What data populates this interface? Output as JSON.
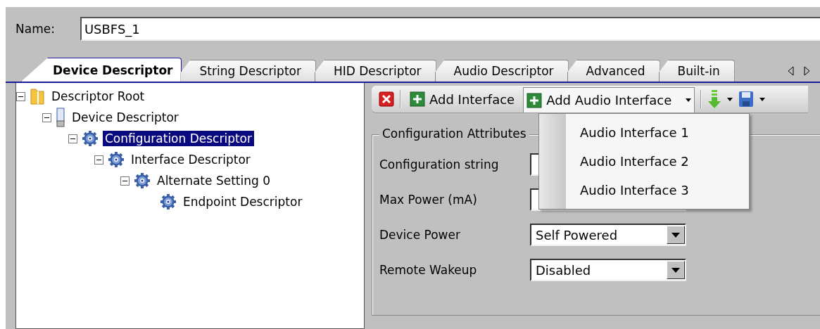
{
  "name_field": {
    "label": "Name:",
    "value": "USBFS_1"
  },
  "tabs": [
    {
      "label": "Device Descriptor",
      "selected": true
    },
    {
      "label": "String Descriptor",
      "selected": false
    },
    {
      "label": "HID Descriptor",
      "selected": false
    },
    {
      "label": "Audio Descriptor",
      "selected": false
    },
    {
      "label": "Advanced",
      "selected": false
    },
    {
      "label": "Built-in",
      "selected": false
    }
  ],
  "tree": [
    {
      "label": "Descriptor Root",
      "kind": "folder",
      "expanded": true,
      "selected": false,
      "children": [
        {
          "label": "Device Descriptor",
          "kind": "device",
          "expanded": true,
          "selected": false,
          "children": [
            {
              "label": "Configuration Descriptor",
              "kind": "gear",
              "expanded": true,
              "selected": true,
              "children": [
                {
                  "label": "Interface Descriptor",
                  "kind": "gear",
                  "expanded": true,
                  "selected": false,
                  "children": [
                    {
                      "label": "Alternate Setting 0",
                      "kind": "gear",
                      "expanded": true,
                      "selected": false,
                      "children": [
                        {
                          "label": "Endpoint Descriptor",
                          "kind": "gear",
                          "selected": false
                        }
                      ]
                    }
                  ]
                }
              ]
            }
          ]
        }
      ]
    }
  ],
  "toolbar": {
    "add_interface": "Add Interface",
    "add_audio_interface": "Add Audio Interface"
  },
  "dropdown_menu": [
    "Audio Interface 1",
    "Audio Interface 2",
    "Audio Interface 3"
  ],
  "group": {
    "title": "Configuration Attributes",
    "fields": [
      {
        "label": "Configuration string",
        "kind": "text"
      },
      {
        "label": "Max Power (mA)",
        "kind": "combo"
      },
      {
        "label": "Device Power",
        "kind": "combo",
        "value": "Self Powered"
      },
      {
        "label": "Remote Wakeup",
        "kind": "combo",
        "value": "Disabled"
      }
    ]
  }
}
